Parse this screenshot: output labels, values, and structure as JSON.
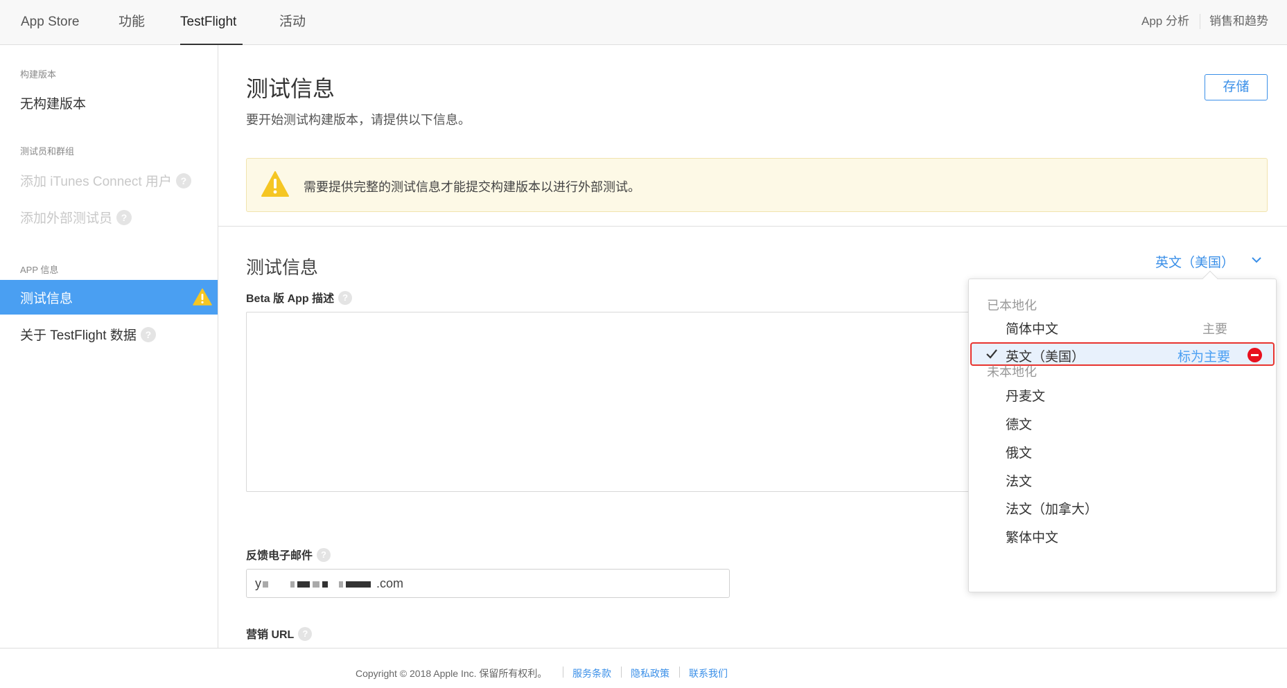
{
  "topnav": {
    "tabs": [
      "App Store",
      "功能",
      "TestFlight",
      "活动"
    ],
    "active_tab": "TestFlight",
    "right_links": [
      "App 分析",
      "销售和趋势"
    ]
  },
  "sidebar": {
    "build_heading": "构建版本",
    "build_item": "无构建版本",
    "testers_heading": "测试员和群组",
    "add_itunes_user": "添加 iTunes Connect 用户",
    "add_external_tester": "添加外部测试员",
    "app_info_heading": "APP 信息",
    "test_info": "测试信息",
    "about_testflight": "关于 TestFlight 数据",
    "help_glyph": "?"
  },
  "main": {
    "title": "测试信息",
    "subtitle": "要开始测试构建版本，请提供以下信息。",
    "save_label": "存储",
    "alert_message": "需要提供完整的测试信息才能提交构建版本以进行外部测试。",
    "section_title": "测试信息",
    "language_selected": "英文（美国）",
    "beta_desc_label": "Beta 版 App 描述",
    "feedback_email_label": "反馈电子邮件",
    "feedback_email_prefix": "y",
    "feedback_email_suffix": ".com",
    "marketing_url_label": "营销 URL"
  },
  "dropdown": {
    "localized_heading": "已本地化",
    "localized": [
      {
        "label": "简体中文",
        "tag": "主要"
      },
      {
        "label": "英文（美国）",
        "action": "标为主要",
        "selected": true
      }
    ],
    "unlocalized_heading": "未本地化",
    "unlocalized": [
      "丹麦文",
      "德文",
      "俄文",
      "法文",
      "法文（加拿大）",
      "繁体中文"
    ]
  },
  "footer": {
    "copyright": "Copyright © 2018 Apple Inc. 保留所有权利。",
    "links": [
      "服务条款",
      "隐私政策",
      "联系我们"
    ]
  },
  "colors": {
    "accent": "#3a8fe8",
    "sidebar_active": "#4a9ff2",
    "warning": "#f5c623",
    "highlight_border": "#e8332e",
    "remove": "#e8101e"
  }
}
